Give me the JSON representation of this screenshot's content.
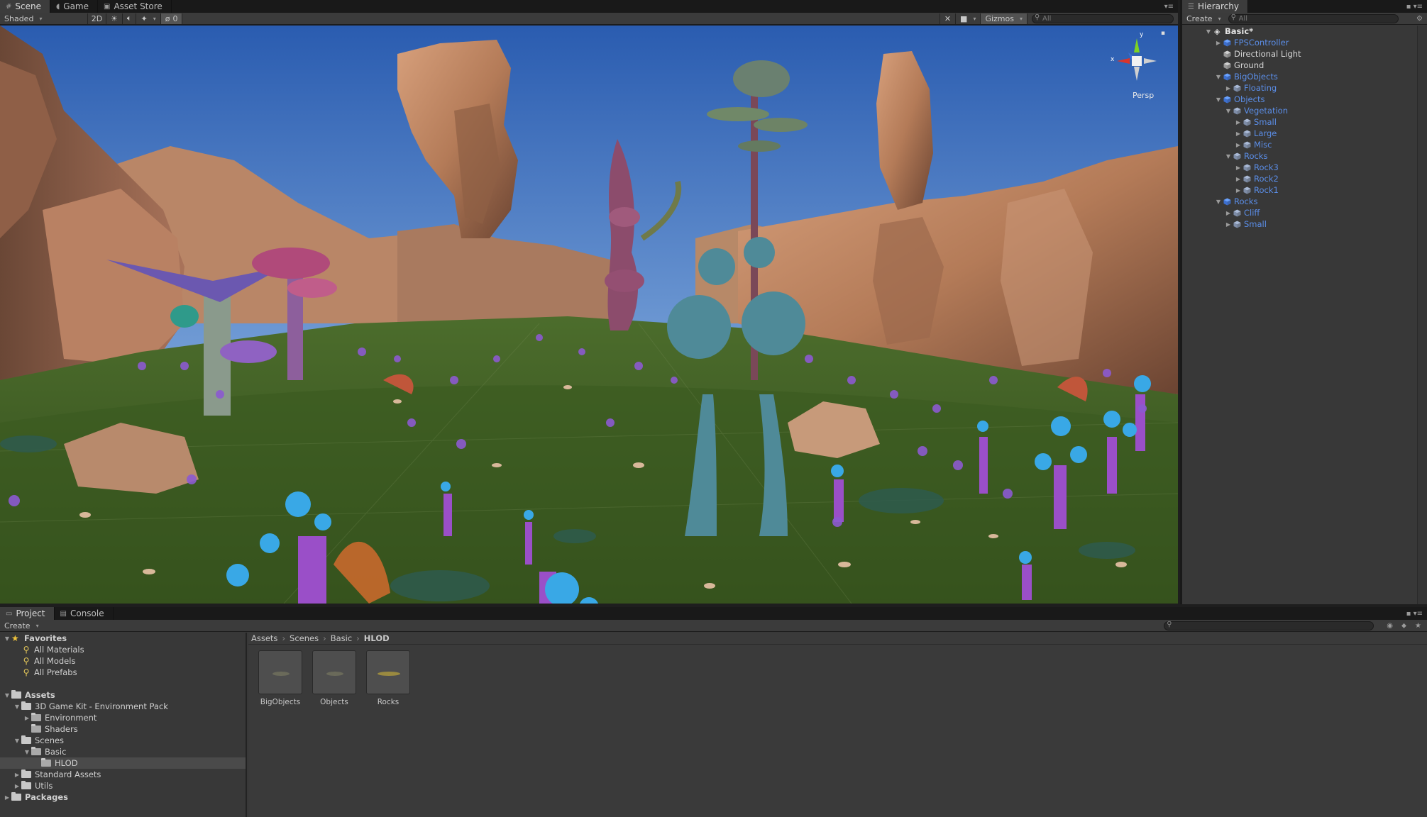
{
  "scene_tabs": [
    {
      "label": "Scene",
      "icon": "grid-icon"
    },
    {
      "label": "Game",
      "icon": "pacman-icon"
    },
    {
      "label": "Asset Store",
      "icon": "lock-icon"
    }
  ],
  "scene_toolbar": {
    "draw_mode": "Shaded",
    "mode_2d": "2D",
    "hidden_count": "0",
    "gizmos_label": "Gizmos",
    "search_placeholder": "All"
  },
  "gizmo": {
    "projection_label": "Persp",
    "axis_x": "x",
    "axis_y": "y",
    "axis_z": "z"
  },
  "hierarchy": {
    "tab_label": "Hierarchy",
    "create_label": "Create",
    "search_placeholder": "All",
    "scene_name": "Basic*",
    "items": [
      {
        "label": "FPSController",
        "depth": 1,
        "arrow": "right",
        "color": "blue",
        "icon": "prefab-cube-icon",
        "more": true
      },
      {
        "label": "Directional Light",
        "depth": 1,
        "arrow": "",
        "color": "white",
        "icon": "gameobject-cube-icon",
        "more": false
      },
      {
        "label": "Ground",
        "depth": 1,
        "arrow": "",
        "color": "white",
        "icon": "gameobject-cube-icon",
        "more": false
      },
      {
        "label": "BigObjects",
        "depth": 1,
        "arrow": "down",
        "color": "blue",
        "icon": "prefab-cube-icon",
        "more": true
      },
      {
        "label": "Floating",
        "depth": 2,
        "arrow": "right",
        "color": "blue",
        "icon": "gameobject-cube-icon",
        "more": false
      },
      {
        "label": "Objects",
        "depth": 1,
        "arrow": "down",
        "color": "blue",
        "icon": "prefab-cube-icon",
        "more": true
      },
      {
        "label": "Vegetation",
        "depth": 2,
        "arrow": "down",
        "color": "blue",
        "icon": "gameobject-cube-icon",
        "more": false
      },
      {
        "label": "Small",
        "depth": 3,
        "arrow": "right",
        "color": "blue",
        "icon": "gameobject-cube-icon",
        "more": false
      },
      {
        "label": "Large",
        "depth": 3,
        "arrow": "right",
        "color": "blue",
        "icon": "gameobject-cube-icon",
        "more": false
      },
      {
        "label": "Misc",
        "depth": 3,
        "arrow": "right",
        "color": "blue",
        "icon": "gameobject-cube-icon",
        "more": false
      },
      {
        "label": "Rocks",
        "depth": 2,
        "arrow": "down",
        "color": "blue",
        "icon": "gameobject-cube-icon",
        "more": false
      },
      {
        "label": "Rock3",
        "depth": 3,
        "arrow": "right",
        "color": "blue",
        "icon": "gameobject-cube-icon",
        "more": false
      },
      {
        "label": "Rock2",
        "depth": 3,
        "arrow": "right",
        "color": "blue",
        "icon": "gameobject-cube-icon",
        "more": false
      },
      {
        "label": "Rock1",
        "depth": 3,
        "arrow": "right",
        "color": "blue",
        "icon": "gameobject-cube-icon",
        "more": false
      },
      {
        "label": "Rocks",
        "depth": 1,
        "arrow": "down",
        "color": "blue",
        "icon": "prefab-cube-icon",
        "more": true
      },
      {
        "label": "Cliff",
        "depth": 2,
        "arrow": "right",
        "color": "blue",
        "icon": "gameobject-cube-icon",
        "more": false
      },
      {
        "label": "Small",
        "depth": 2,
        "arrow": "right",
        "color": "blue",
        "icon": "gameobject-cube-icon",
        "more": false
      }
    ]
  },
  "project": {
    "tabs": [
      {
        "label": "Project",
        "icon": "folder-icon"
      },
      {
        "label": "Console",
        "icon": "console-icon"
      }
    ],
    "create_label": "Create",
    "tree": [
      {
        "label": "Favorites",
        "depth": 0,
        "arrow": "down",
        "icon": "star-icon",
        "bold": true,
        "selected": false
      },
      {
        "label": "All Materials",
        "depth": 1,
        "arrow": "",
        "icon": "search-icon",
        "bold": false,
        "selected": false
      },
      {
        "label": "All Models",
        "depth": 1,
        "arrow": "",
        "icon": "search-icon",
        "bold": false,
        "selected": false
      },
      {
        "label": "All Prefabs",
        "depth": 1,
        "arrow": "",
        "icon": "search-icon",
        "bold": false,
        "selected": false
      },
      {
        "label": "",
        "depth": 0,
        "arrow": "",
        "icon": "",
        "bold": false,
        "selected": false
      },
      {
        "label": "Assets",
        "depth": 0,
        "arrow": "down",
        "icon": "folder-icon",
        "bold": true,
        "selected": false
      },
      {
        "label": "3D Game Kit - Environment Pack",
        "depth": 1,
        "arrow": "down",
        "icon": "folder-icon",
        "bold": false,
        "selected": false
      },
      {
        "label": "Environment",
        "depth": 2,
        "arrow": "right",
        "icon": "folder-icon",
        "bold": false,
        "selected": false
      },
      {
        "label": "Shaders",
        "depth": 2,
        "arrow": "",
        "icon": "folder-icon",
        "bold": false,
        "selected": false
      },
      {
        "label": "Scenes",
        "depth": 1,
        "arrow": "down",
        "icon": "folder-icon",
        "bold": false,
        "selected": false
      },
      {
        "label": "Basic",
        "depth": 2,
        "arrow": "down",
        "icon": "folder-icon",
        "bold": false,
        "selected": false
      },
      {
        "label": "HLOD",
        "depth": 3,
        "arrow": "",
        "icon": "folder-icon",
        "bold": false,
        "selected": true
      },
      {
        "label": "Standard Assets",
        "depth": 1,
        "arrow": "right",
        "icon": "folder-icon",
        "bold": false,
        "selected": false
      },
      {
        "label": "Utils",
        "depth": 1,
        "arrow": "right",
        "icon": "folder-icon",
        "bold": false,
        "selected": false
      },
      {
        "label": "Packages",
        "depth": 0,
        "arrow": "right",
        "icon": "folder-icon",
        "bold": true,
        "selected": false
      }
    ],
    "breadcrumb": [
      "Assets",
      "Scenes",
      "Basic",
      "HLOD"
    ],
    "assets": [
      {
        "label": "BigObjects",
        "icon": "prefab-thumbnail-icon"
      },
      {
        "label": "Objects",
        "icon": "prefab-thumbnail-icon"
      },
      {
        "label": "Rocks",
        "icon": "prefab-thumbnail-icon"
      }
    ]
  },
  "colors": {
    "sky_top": "#2c5fb4",
    "sky_bottom": "#b9d2ea",
    "ground": "#3d5a24",
    "rock": "#b9825e",
    "plant_purple": "#9a4fc8",
    "plant_cyan": "#39a8e6",
    "prefab_blue": "#5b8ee8"
  }
}
